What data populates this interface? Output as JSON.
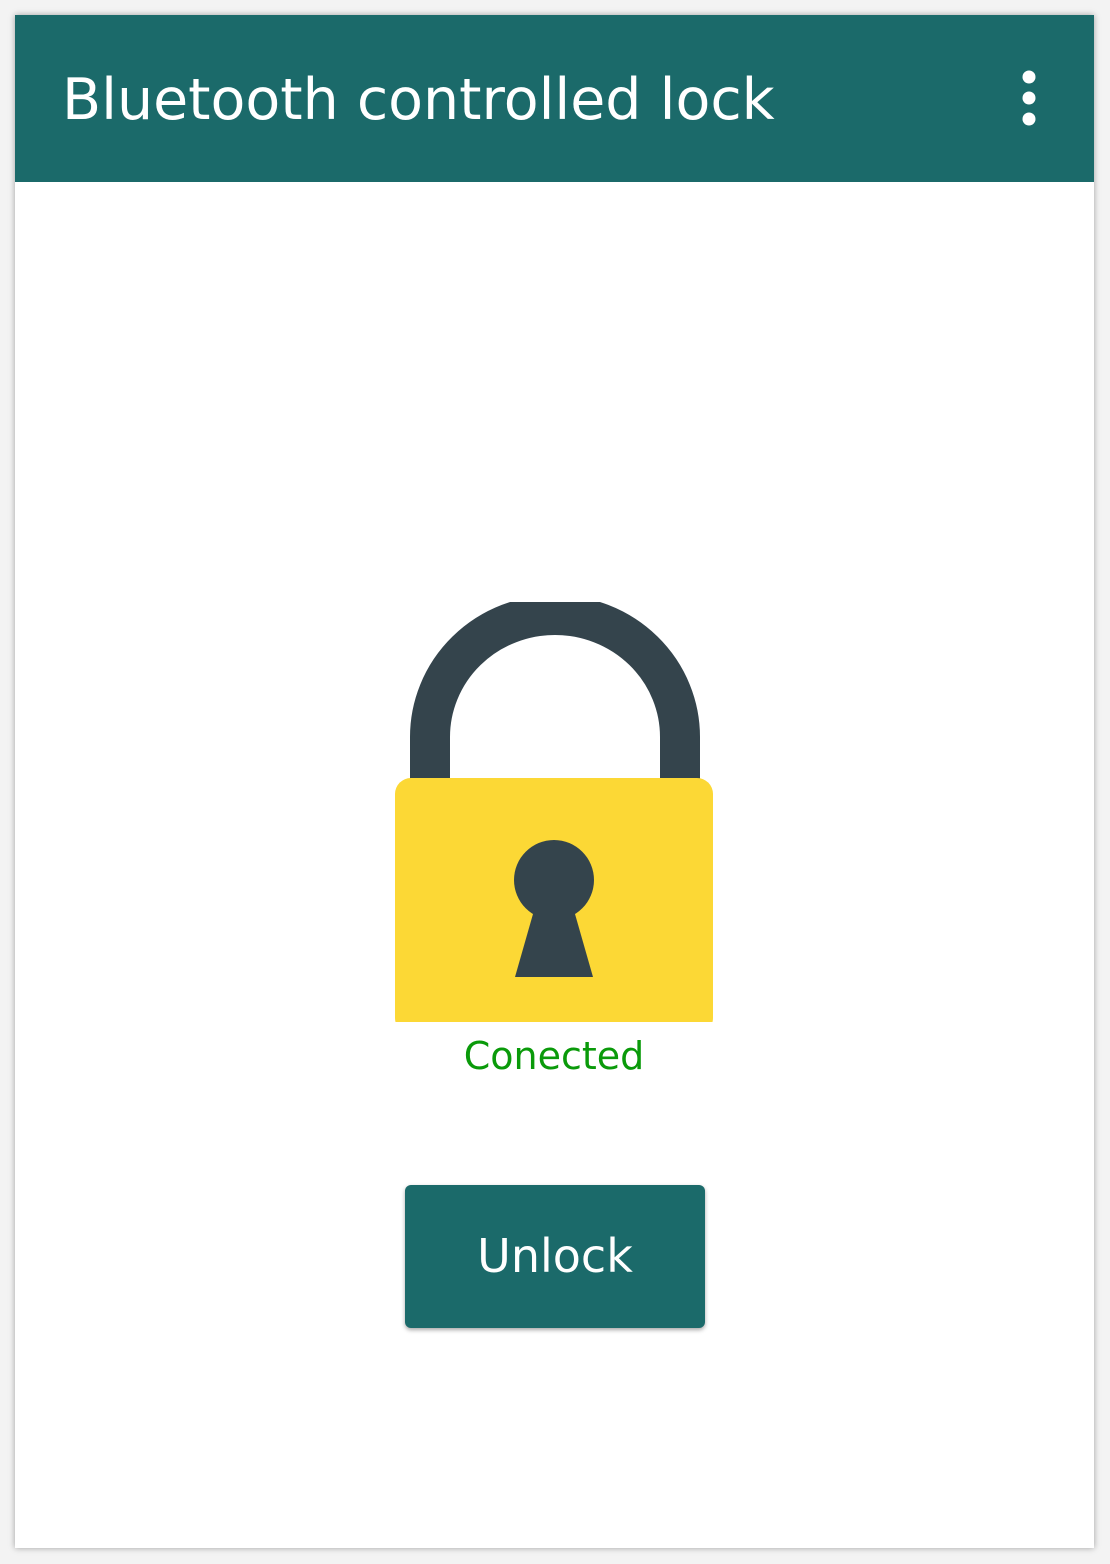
{
  "app_bar": {
    "title": "Bluetooth controlled lock",
    "menu_icon": "more-vert-icon",
    "background_color": "#1b6a6a"
  },
  "main": {
    "lock_icon": "padlock-icon",
    "status_text": "Conected",
    "status_color": "#0a9a0a",
    "unlock_button_label": "Unlock"
  },
  "colors": {
    "lock_body": "#fcd835",
    "lock_shackle": "#34444c",
    "button": "#1b6a6a"
  }
}
